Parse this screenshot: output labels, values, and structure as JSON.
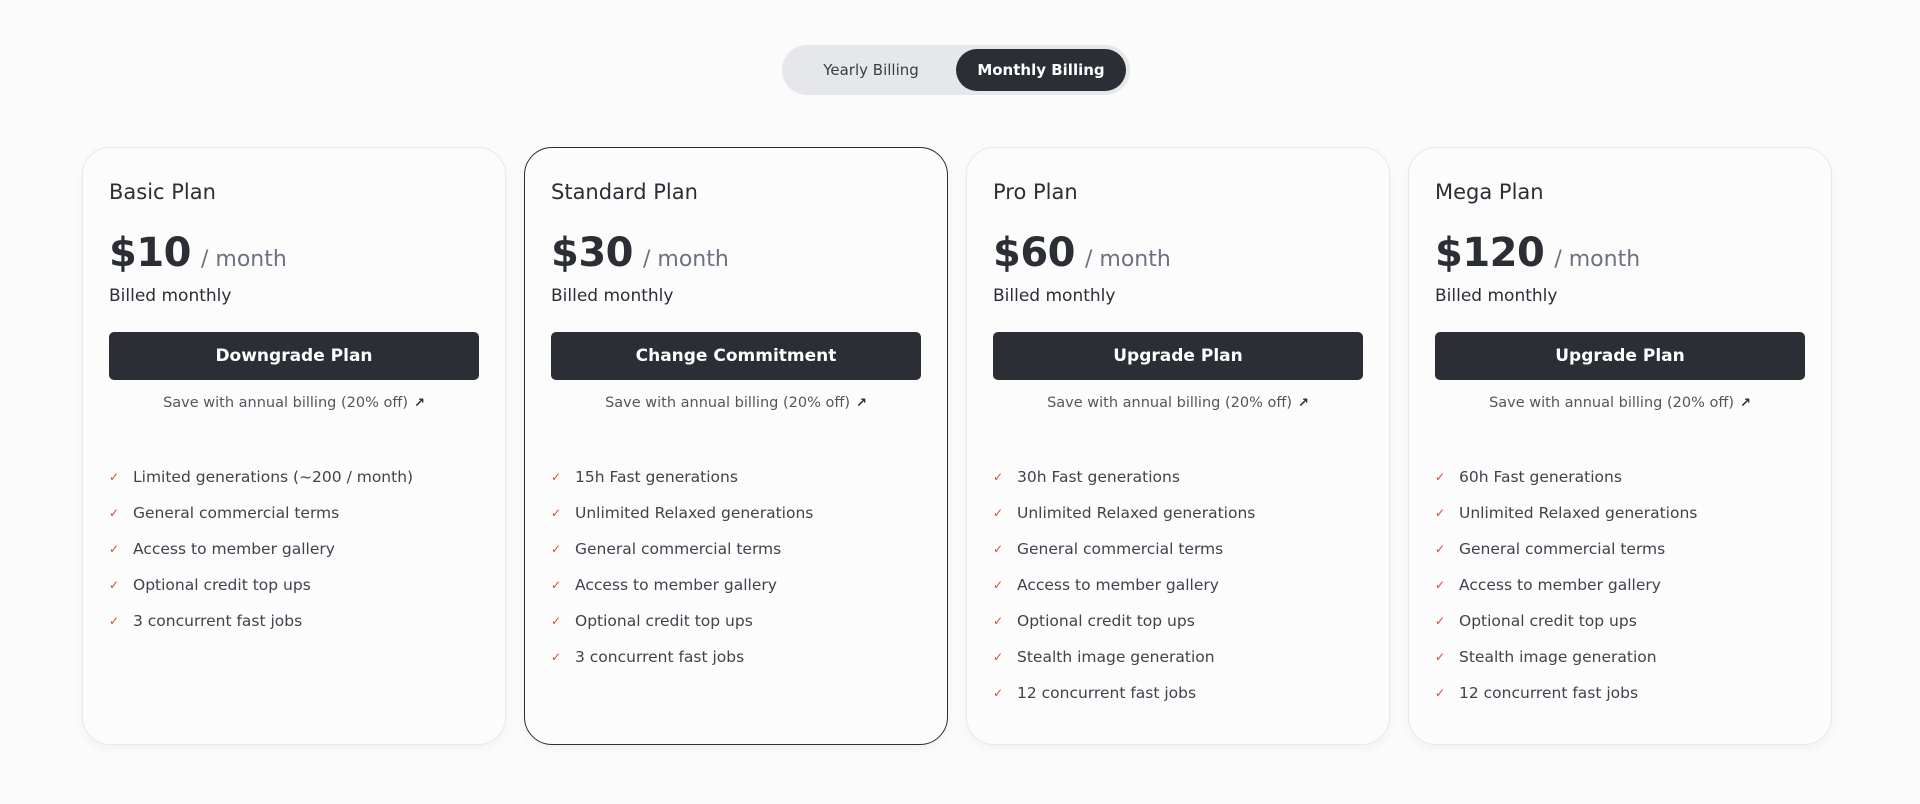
{
  "billing_toggle": {
    "options": [
      {
        "label": "Yearly Billing",
        "selected": false
      },
      {
        "label": "Monthly Billing",
        "selected": true
      }
    ]
  },
  "colors": {
    "primary": "#2b2e35",
    "check": "#d8482f",
    "background": "#fbfbfc"
  },
  "plans": [
    {
      "name": "Basic Plan",
      "price": "$10",
      "period": "/ month",
      "billed": "Billed monthly",
      "cta": "Downgrade Plan",
      "save_link": "Save with annual billing (20% off)",
      "featured": false,
      "features": [
        "Limited generations (~200 / month)",
        "General commercial terms",
        "Access to member gallery",
        "Optional credit top ups",
        "3 concurrent fast jobs"
      ]
    },
    {
      "name": "Standard Plan",
      "price": "$30",
      "period": "/ month",
      "billed": "Billed monthly",
      "cta": "Change Commitment",
      "save_link": "Save with annual billing (20% off)",
      "featured": true,
      "features": [
        "15h Fast generations",
        "Unlimited Relaxed generations",
        "General commercial terms",
        "Access to member gallery",
        "Optional credit top ups",
        "3 concurrent fast jobs"
      ]
    },
    {
      "name": "Pro Plan",
      "price": "$60",
      "period": "/ month",
      "billed": "Billed monthly",
      "cta": "Upgrade Plan",
      "save_link": "Save with annual billing (20% off)",
      "featured": false,
      "features": [
        "30h Fast generations",
        "Unlimited Relaxed generations",
        "General commercial terms",
        "Access to member gallery",
        "Optional credit top ups",
        "Stealth image generation",
        "12 concurrent fast jobs"
      ]
    },
    {
      "name": "Mega Plan",
      "price": "$120",
      "period": "/ month",
      "billed": "Billed monthly",
      "cta": "Upgrade Plan",
      "save_link": "Save with annual billing (20% off)",
      "featured": false,
      "features": [
        "60h Fast generations",
        "Unlimited Relaxed generations",
        "General commercial terms",
        "Access to member gallery",
        "Optional credit top ups",
        "Stealth image generation",
        "12 concurrent fast jobs"
      ]
    }
  ],
  "icons": {
    "check": "✓",
    "arrow": "↗"
  }
}
